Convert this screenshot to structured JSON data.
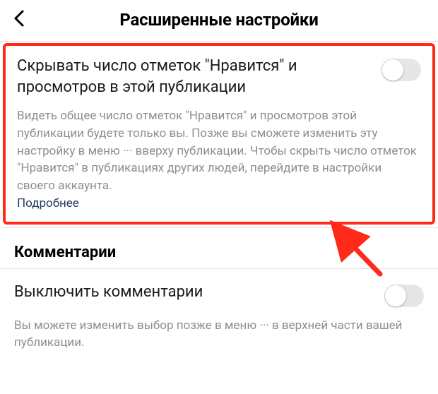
{
  "header": {
    "title": "Расширенные настройки"
  },
  "sections": {
    "hideLikes": {
      "title": "Скрывать число отметок \"Нравится\" и просмотров в этой публикации",
      "description": "Видеть общее число отметок \"Нравится\" и просмотров этой публикации будете только вы. Позже вы сможете изменить эту настройку в меню ··· вверху публикации. Чтобы скрыть число отметок \"Нравится\" в публикациях других людей, перейдите в настройки своего аккаунта.",
      "moreLabel": "Подробнее"
    },
    "commentsHeading": "Комментарии",
    "disableComments": {
      "title": "Выключить комментарии",
      "description": "Вы можете изменить выбор позже в меню ··· в верхней части вашей публикации."
    }
  }
}
